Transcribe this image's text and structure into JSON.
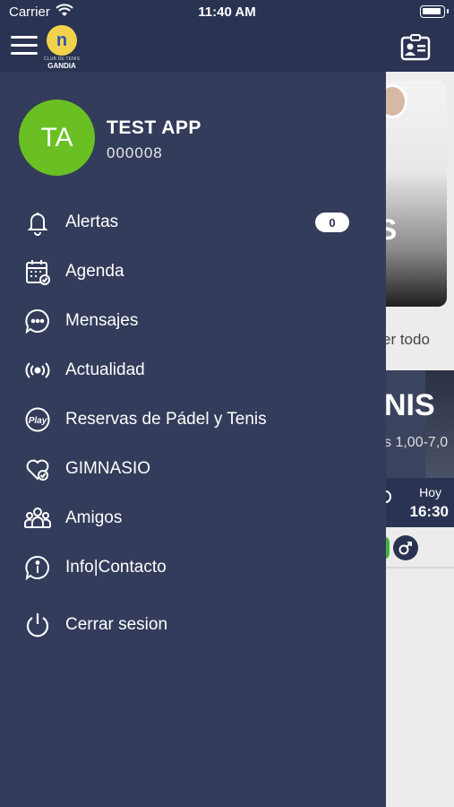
{
  "status_bar": {
    "carrier": "Carrier",
    "time": "11:40 AM"
  },
  "logo": {
    "letter": "n",
    "subtitle": "CLUB DE TENIS",
    "name": "GANDIA"
  },
  "profile": {
    "initials": "TA",
    "name": "TEST APP",
    "id": "000008"
  },
  "menu": [
    {
      "label": "Alertas",
      "icon": "bell-icon",
      "badge": "0"
    },
    {
      "label": "Agenda",
      "icon": "calendar-check-icon"
    },
    {
      "label": "Mensajes",
      "icon": "chat-bubble-icon"
    },
    {
      "label": "Actualidad",
      "icon": "broadcast-icon"
    },
    {
      "label": "Reservas de Pádel y Tenis",
      "icon": "play-badge-icon"
    },
    {
      "label": "GIMNASIO",
      "icon": "heart-check-icon"
    },
    {
      "label": "Amigos",
      "icon": "group-icon"
    },
    {
      "label": "Info|Contacto",
      "icon": "info-bubble-icon"
    },
    {
      "label": "Cerrar sesion",
      "icon": "power-icon"
    }
  ],
  "background": {
    "card_partial_text": "IS",
    "see_all": "er todo",
    "promo_partial_title": "NIS",
    "promo_partial_price": "s 1,00-7,0",
    "day_label": "Hoy",
    "time_label": "16:30"
  },
  "colors": {
    "drawer": "#333c5a",
    "header": "#2a3352",
    "avatar": "#6ac022"
  }
}
